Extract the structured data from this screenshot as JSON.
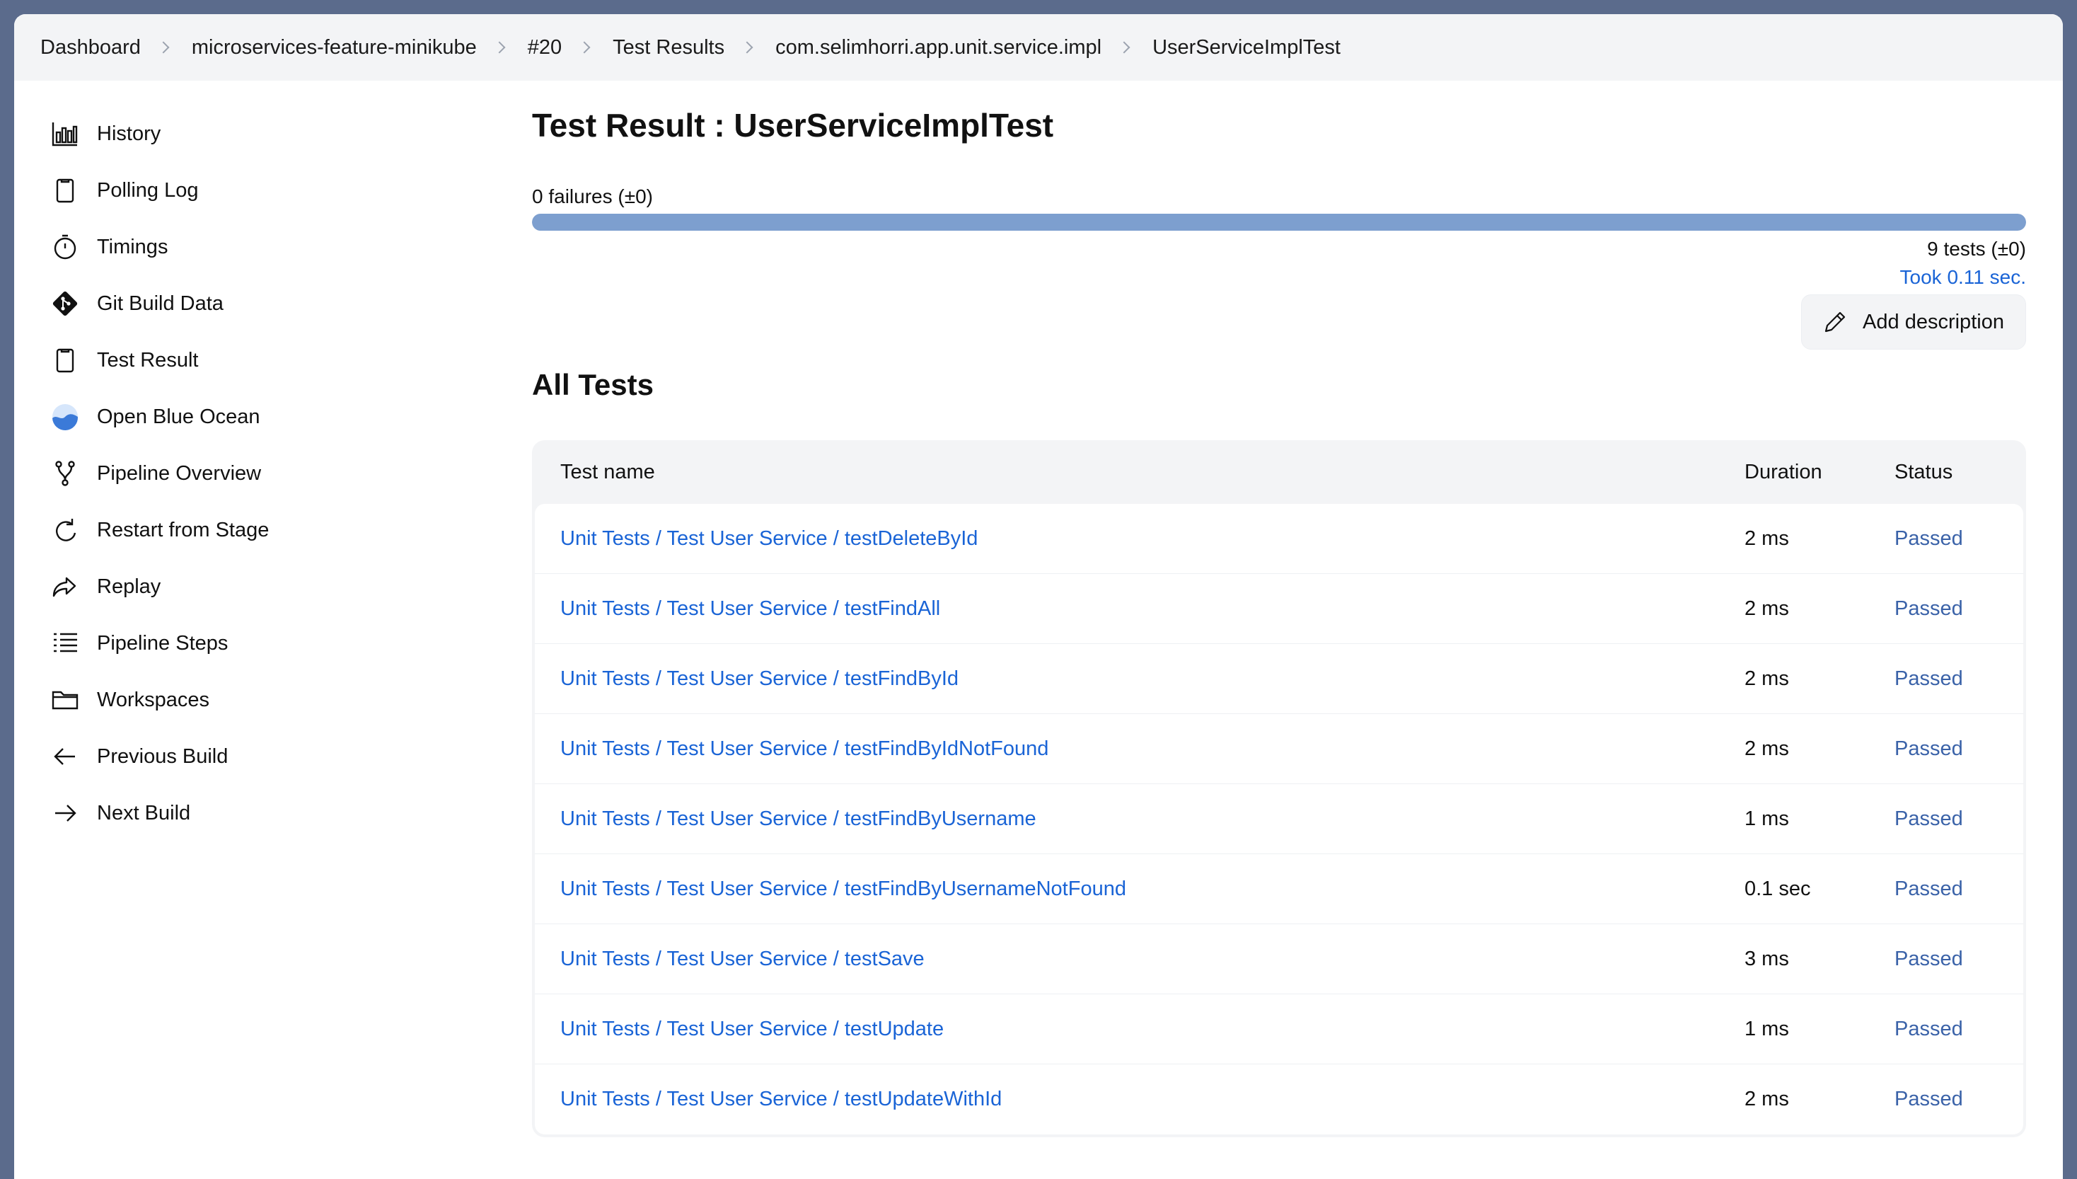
{
  "breadcrumb": [
    "Dashboard",
    "microservices-feature-minikube",
    "#20",
    "Test Results",
    "com.selimhorri.app.unit.service.impl",
    "UserServiceImplTest"
  ],
  "sidebar": {
    "items": [
      {
        "label": "History",
        "icon": "bar-chart-icon"
      },
      {
        "label": "Polling Log",
        "icon": "clipboard-icon"
      },
      {
        "label": "Timings",
        "icon": "stopwatch-icon"
      },
      {
        "label": "Git Build Data",
        "icon": "git-icon"
      },
      {
        "label": "Test Result",
        "icon": "clipboard-icon"
      },
      {
        "label": "Open Blue Ocean",
        "icon": "blue-ocean-icon"
      },
      {
        "label": "Pipeline Overview",
        "icon": "branch-icon"
      },
      {
        "label": "Restart from Stage",
        "icon": "restart-icon"
      },
      {
        "label": "Replay",
        "icon": "replay-icon"
      },
      {
        "label": "Pipeline Steps",
        "icon": "list-icon"
      },
      {
        "label": "Workspaces",
        "icon": "folder-icon"
      },
      {
        "label": "Previous Build",
        "icon": "arrow-left-icon"
      },
      {
        "label": "Next Build",
        "icon": "arrow-right-icon"
      }
    ]
  },
  "main": {
    "title": "Test Result : UserServiceImplTest",
    "failures": "0 failures (±0)",
    "progress_pass_fraction": 1.0,
    "tests_count": "9 tests (±0)",
    "took": "Took 0.11 sec.",
    "add_description": "Add description",
    "section_title": "All Tests",
    "table": {
      "headers": {
        "name": "Test name",
        "duration": "Duration",
        "status": "Status"
      },
      "rows": [
        {
          "name": "Unit Tests / Test User Service / testDeleteById",
          "duration": "2 ms",
          "status": "Passed"
        },
        {
          "name": "Unit Tests / Test User Service / testFindAll",
          "duration": "2 ms",
          "status": "Passed"
        },
        {
          "name": "Unit Tests / Test User Service / testFindById",
          "duration": "2 ms",
          "status": "Passed"
        },
        {
          "name": "Unit Tests / Test User Service / testFindByIdNotFound",
          "duration": "2 ms",
          "status": "Passed"
        },
        {
          "name": "Unit Tests / Test User Service / testFindByUsername",
          "duration": "1 ms",
          "status": "Passed"
        },
        {
          "name": "Unit Tests / Test User Service / testFindByUsernameNotFound",
          "duration": "0.1 sec",
          "status": "Passed"
        },
        {
          "name": "Unit Tests / Test User Service / testSave",
          "duration": "3 ms",
          "status": "Passed"
        },
        {
          "name": "Unit Tests / Test User Service / testUpdate",
          "duration": "1 ms",
          "status": "Passed"
        },
        {
          "name": "Unit Tests / Test User Service / testUpdateWithId",
          "duration": "2 ms",
          "status": "Passed"
        }
      ]
    }
  },
  "colors": {
    "link": "#1a64d6",
    "progress": "#7d9fcf",
    "status_passed": "#3a62a8"
  }
}
